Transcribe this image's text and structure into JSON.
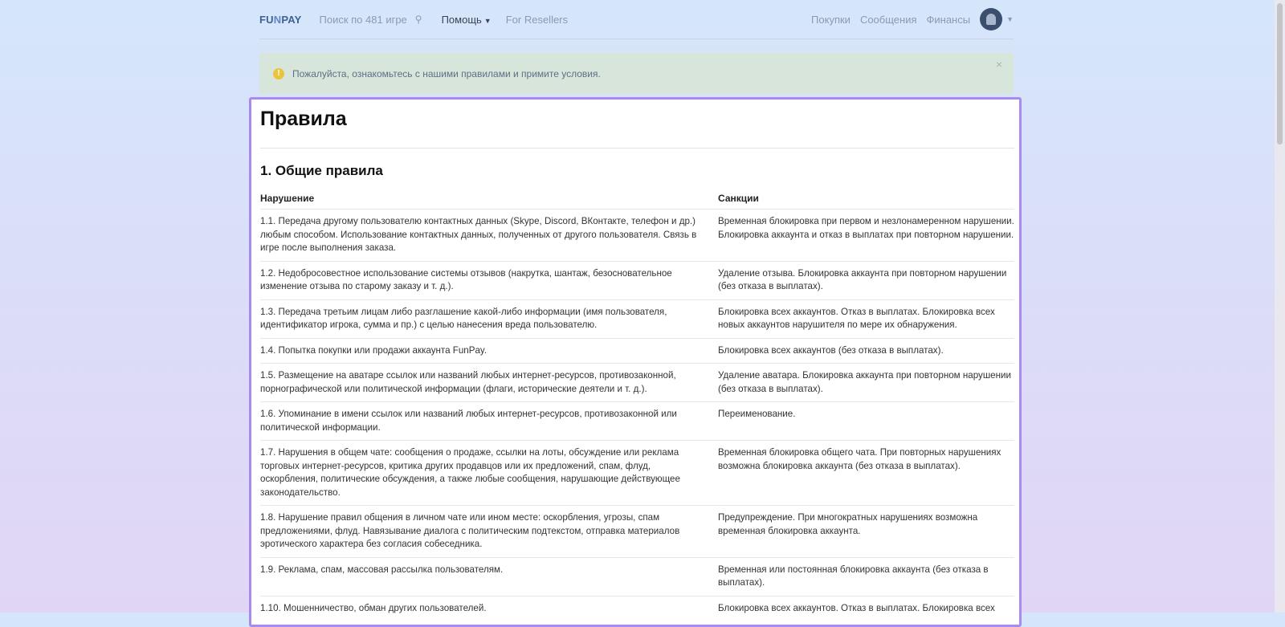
{
  "navbar": {
    "logo_main": "FU",
    "logo_accent": "N",
    "logo_tail": "PAY",
    "search_placeholder": "Поиск по 481 игре",
    "help_label": "Помощь",
    "resellers_label": "For Resellers",
    "purchases_label": "Покупки",
    "messages_label": "Сообщения",
    "finances_label": "Финансы"
  },
  "alert": {
    "text": "Пожалуйста, ознакомьтесь с нашими правилами и примите условия.",
    "close": "×"
  },
  "page": {
    "title": "Правила",
    "section_title": "1. Общие правила",
    "col_violation": "Нарушение",
    "col_sanctions": "Санкции"
  },
  "rules": [
    {
      "violation": "1.1. Передача другому пользователю контактных данных (Skype, Discord, ВКонтакте, телефон и др.) любым способом. Использование контактных данных, полученных от другого пользователя. Связь в игре после выполнения заказа.",
      "sanction": "Временная блокировка при первом и незлонамеренном нарушении. Блокировка аккаунта и отказ в выплатах при повторном нарушении."
    },
    {
      "violation": "1.2. Недобросовестное использование системы отзывов (накрутка, шантаж, безосновательное изменение отзыва по старому заказу и т. д.).",
      "sanction": "Удаление отзыва. Блокировка аккаунта при повторном нарушении (без отказа в выплатах)."
    },
    {
      "violation": "1.3. Передача третьим лицам либо разглашение какой-либо информации (имя пользователя, идентификатор игрока, сумма и пр.) с целью нанесения вреда пользователю.",
      "sanction": "Блокировка всех аккаунтов. Отказ в выплатах. Блокировка всех новых аккаунтов нарушителя по мере их обнаружения."
    },
    {
      "violation": "1.4. Попытка покупки или продажи аккаунта FunPay.",
      "sanction": "Блокировка всех аккаунтов (без отказа в выплатах)."
    },
    {
      "violation": "1.5. Размещение на аватаре ссылок или названий любых интернет-ресурсов, противозаконной, порнографической или политической информации (флаги, исторические деятели и т. д.).",
      "sanction": "Удаление аватара. Блокировка аккаунта при повторном нарушении (без отказа в выплатах)."
    },
    {
      "violation": "1.6. Упоминание в имени ссылок или названий любых интернет-ресурсов, противозаконной или политической информации.",
      "sanction": "Переименование."
    },
    {
      "violation": "1.7. Нарушения в общем чате: сообщения о продаже, ссылки на лоты, обсуждение или реклама торговых интернет-ресурсов, критика других продавцов или их предложений, спам, флуд, оскорбления, политические обсуждения, а также любые сообщения, нарушающие действующее законодательство.",
      "sanction": "Временная блокировка общего чата. При повторных нарушениях возможна блокировка аккаунта (без отказа в выплатах)."
    },
    {
      "violation": "1.8. Нарушение правил общения в личном чате или ином месте: оскорбления, угрозы, спам предложениями, флуд. Навязывание диалога с политическим подтекстом, отправка материалов эротического характера без согласия собеседника.",
      "sanction": "Предупреждение. При многократных нарушениях возможна временная блокировка аккаунта."
    },
    {
      "violation": "1.9. Реклама, спам, массовая рассылка пользователям.",
      "sanction": "Временная или постоянная блокировка аккаунта (без отказа в выплатах)."
    },
    {
      "violation": "1.10. Мошенничество, обман других пользователей.",
      "sanction": "Блокировка всех аккаунтов. Отказ в выплатах. Блокировка всех"
    }
  ]
}
